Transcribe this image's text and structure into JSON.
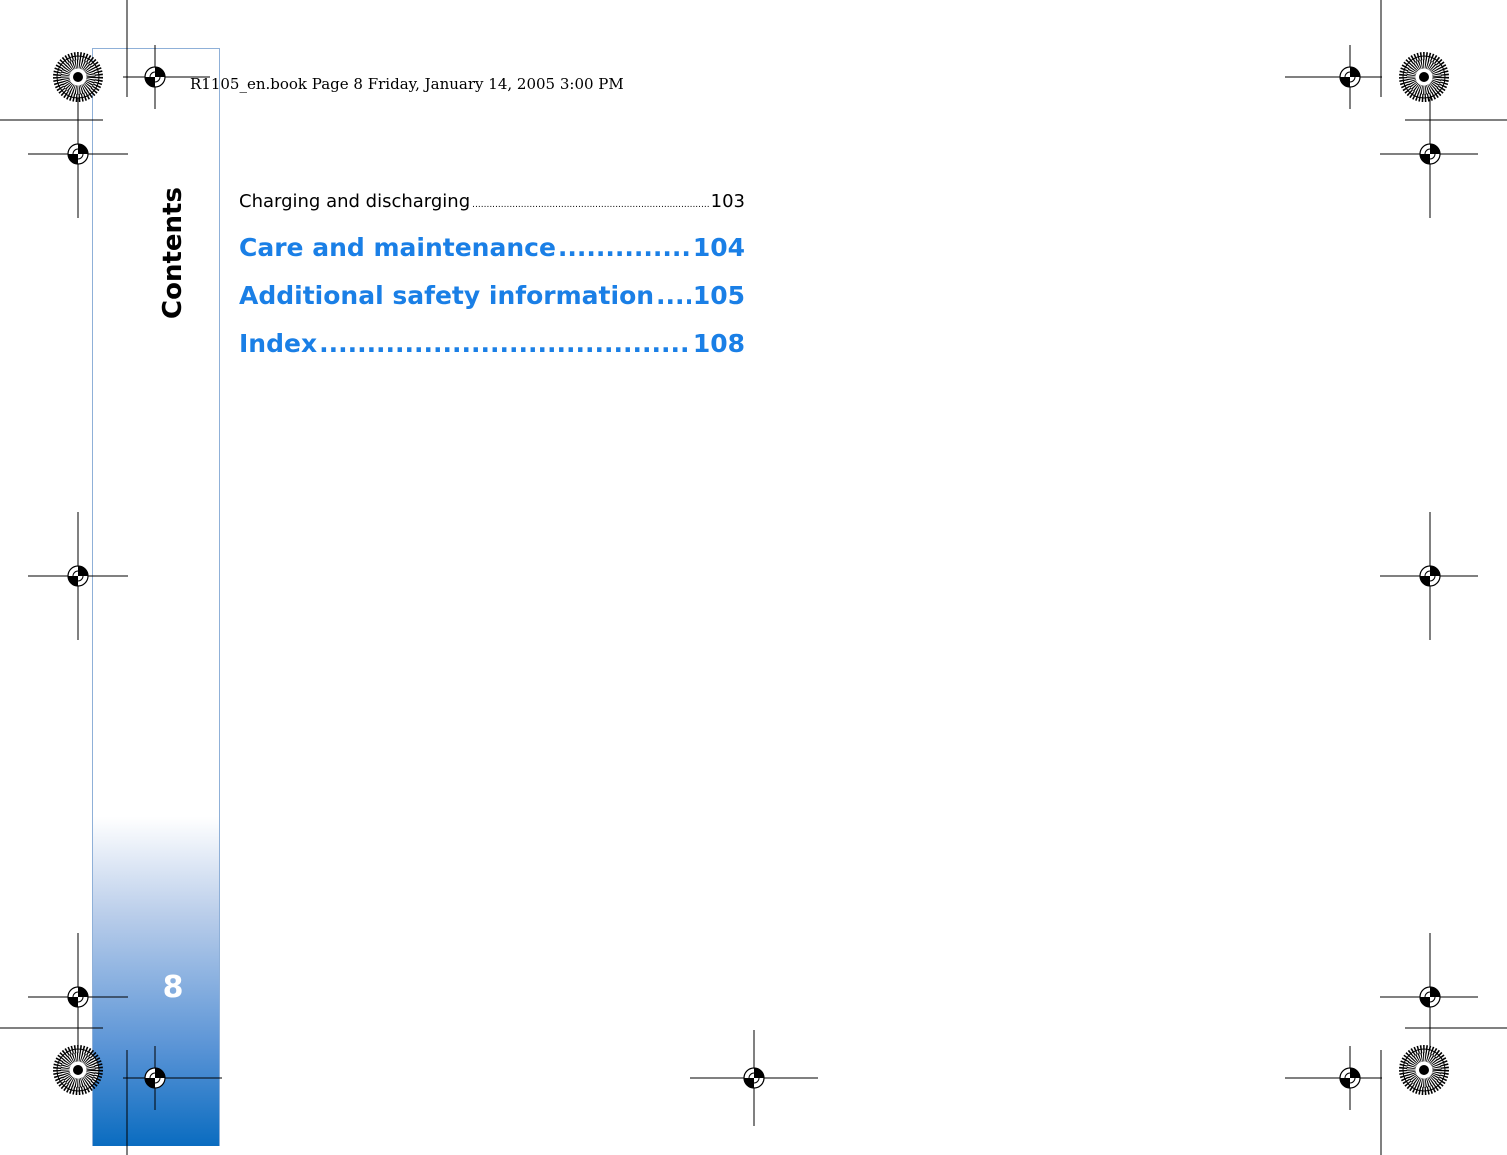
{
  "header": {
    "slug": "R1105_en.book  Page 8  Friday, January 14, 2005  3:00 PM"
  },
  "sidebar": {
    "title": "Contents",
    "page_number": "8"
  },
  "toc": {
    "entries": [
      {
        "label": "Charging and discharging",
        "leader": "............................................................................................",
        "page": "103",
        "style": "small"
      },
      {
        "label": "Care and maintenance",
        "leader": "......................................................",
        "page": "104",
        "style": "big"
      },
      {
        "label": "Additional safety information",
        "leader": "......................................................",
        "page": "105",
        "style": "big"
      },
      {
        "label": "Index",
        "leader": "..............................................................................................",
        "page": "108",
        "style": "big"
      }
    ]
  },
  "colors": {
    "toc_heading": "#1a7fe6",
    "sidebar_bottom": "#0a6cc0",
    "sidebar_border": "#8fb0d8"
  },
  "icons": [
    "registration-mark-icon",
    "star-target-icon"
  ]
}
